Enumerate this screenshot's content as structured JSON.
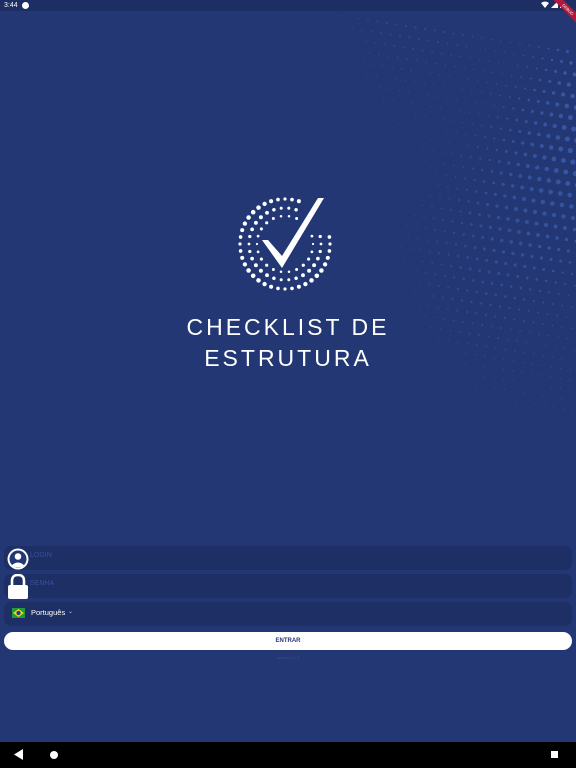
{
  "status_bar": {
    "time": "3:44"
  },
  "debug_banner": "DEBUG",
  "app": {
    "title_line1": "CHECKLIST DE",
    "title_line2": "ESTRUTURA"
  },
  "form": {
    "login_placeholder": "LOGIN",
    "password_placeholder": "SENHA",
    "language_value": "Português",
    "submit_label": "ENTRAR",
    "version": "Versão 1.0.0"
  },
  "icons": {
    "login": "user-circle-icon",
    "password": "lock-icon",
    "language": "brazil-flag-icon",
    "nav_back": "triangle-back-icon",
    "nav_home": "circle-home-icon",
    "nav_recents": "square-recents-icon"
  },
  "colors": {
    "background": "#223774",
    "field": "#1d2f64",
    "button": "#ffffff",
    "button_text": "#223774",
    "wave_dots": "#3f63b5"
  }
}
